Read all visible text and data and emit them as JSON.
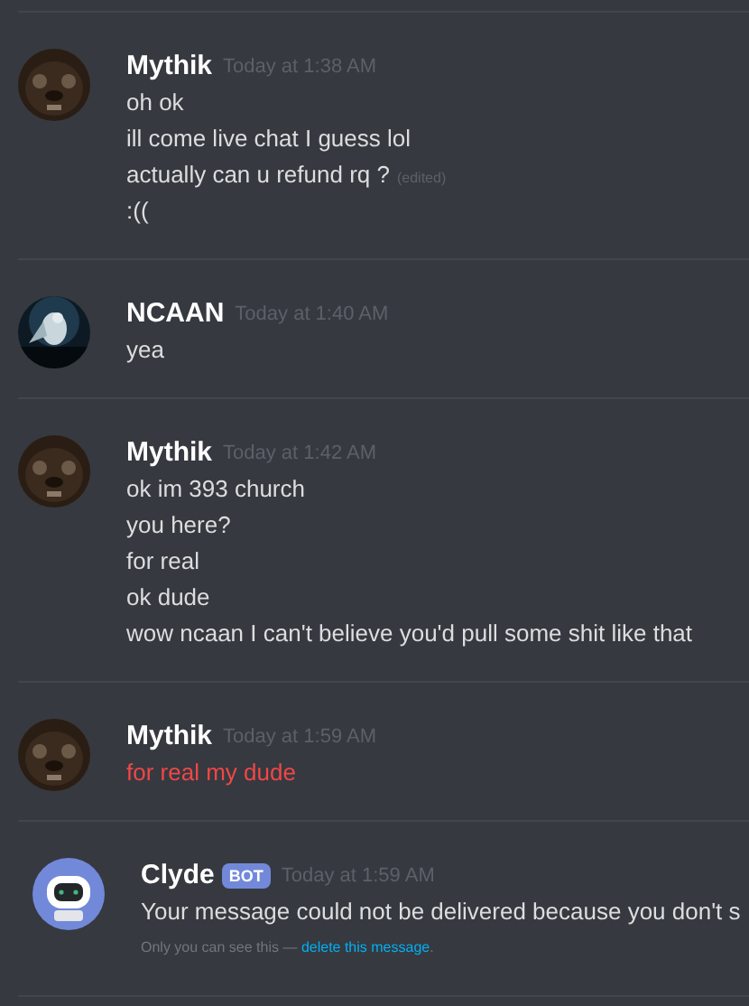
{
  "messages": [
    {
      "kind": "message",
      "author": "Mythik",
      "timestamp": "Today at 1:38 AM",
      "avatar": {
        "kind": "picture"
      },
      "lines": [
        {
          "text": "oh ok",
          "failed": false
        },
        {
          "text": "ill come live chat I guess lol",
          "failed": false
        },
        {
          "text": "actually can u refund rq ?",
          "failed": false,
          "edited_label": "(edited)"
        },
        {
          "text": ":((",
          "failed": false
        }
      ]
    },
    {
      "kind": "message",
      "author": "NCAAN",
      "timestamp": "Today at 1:40 AM",
      "avatar": {
        "kind": "picture"
      },
      "lines": [
        {
          "text": "yea",
          "failed": false
        }
      ]
    },
    {
      "kind": "message",
      "author": "Mythik",
      "timestamp": "Today at 1:42 AM",
      "avatar": {
        "kind": "picture"
      },
      "lines": [
        {
          "text": "ok im 393 church",
          "failed": false
        },
        {
          "text": "you here?",
          "failed": false
        },
        {
          "text": "for real",
          "failed": false
        },
        {
          "text": "ok dude",
          "failed": false
        },
        {
          "text": "wow ncaan I can't believe you'd pull some shit like that",
          "failed": false
        }
      ]
    },
    {
      "kind": "message",
      "author": "Mythik",
      "timestamp": "Today at 1:59 AM",
      "avatar": {
        "kind": "picture"
      },
      "lines": [
        {
          "text": "for real my dude",
          "failed": true
        }
      ]
    },
    {
      "kind": "ephemeral",
      "author": "Clyde",
      "badge": "BOT",
      "timestamp": "Today at 1:59 AM",
      "avatar": {
        "kind": "bot"
      },
      "lines": [
        {
          "text": "Your message could not be delivered because you don't s",
          "failed": false
        }
      ],
      "notice": {
        "before": "Only you can see this — ",
        "link": "delete this message",
        "after": "."
      }
    }
  ]
}
